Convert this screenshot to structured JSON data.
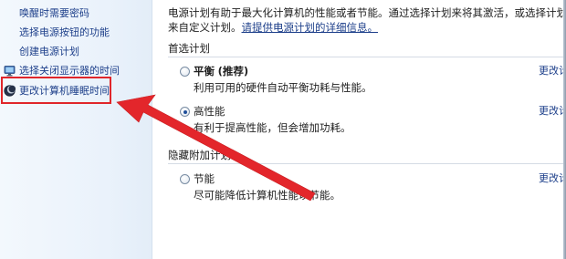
{
  "sidebar": {
    "items": [
      {
        "label": "唤醒时需要密码",
        "icon": "none"
      },
      {
        "label": "选择电源按钮的功能",
        "icon": "none"
      },
      {
        "label": "创建电源计划",
        "icon": "none"
      },
      {
        "label": "选择关闭显示器的时间",
        "icon": "monitor-icon"
      },
      {
        "label": "更改计算机睡眠时间",
        "icon": "moon-icon"
      }
    ]
  },
  "intro": {
    "line1": "电源计划有助于最大化计算机的性能或者节能。通过选择计划来将其激活，或选择计划并通过更改其",
    "line2_prefix": "来自定义计划。",
    "line2_link": "请提供电源计划的详细信息。"
  },
  "preferred": {
    "heading": "首选计划",
    "plans": [
      {
        "name": "平衡",
        "tag": "(推荐)",
        "desc": "利用可用的硬件自动平衡功耗与性能。",
        "checked": false,
        "change_label": "更改计划设置"
      },
      {
        "name": "高性能",
        "tag": "",
        "desc": "有利于提高性能，但会增加功耗。",
        "checked": true,
        "change_label": "更改计划设置"
      }
    ]
  },
  "hidden": {
    "heading": "隐藏附加计划",
    "plans": [
      {
        "name": "节能",
        "tag": "",
        "desc": "尽可能降低计算机性能以节能。",
        "checked": false,
        "change_label": "更改计划设置"
      }
    ]
  },
  "colors": {
    "link": "#1d3f8a",
    "annotation_red": "#e0262a"
  }
}
